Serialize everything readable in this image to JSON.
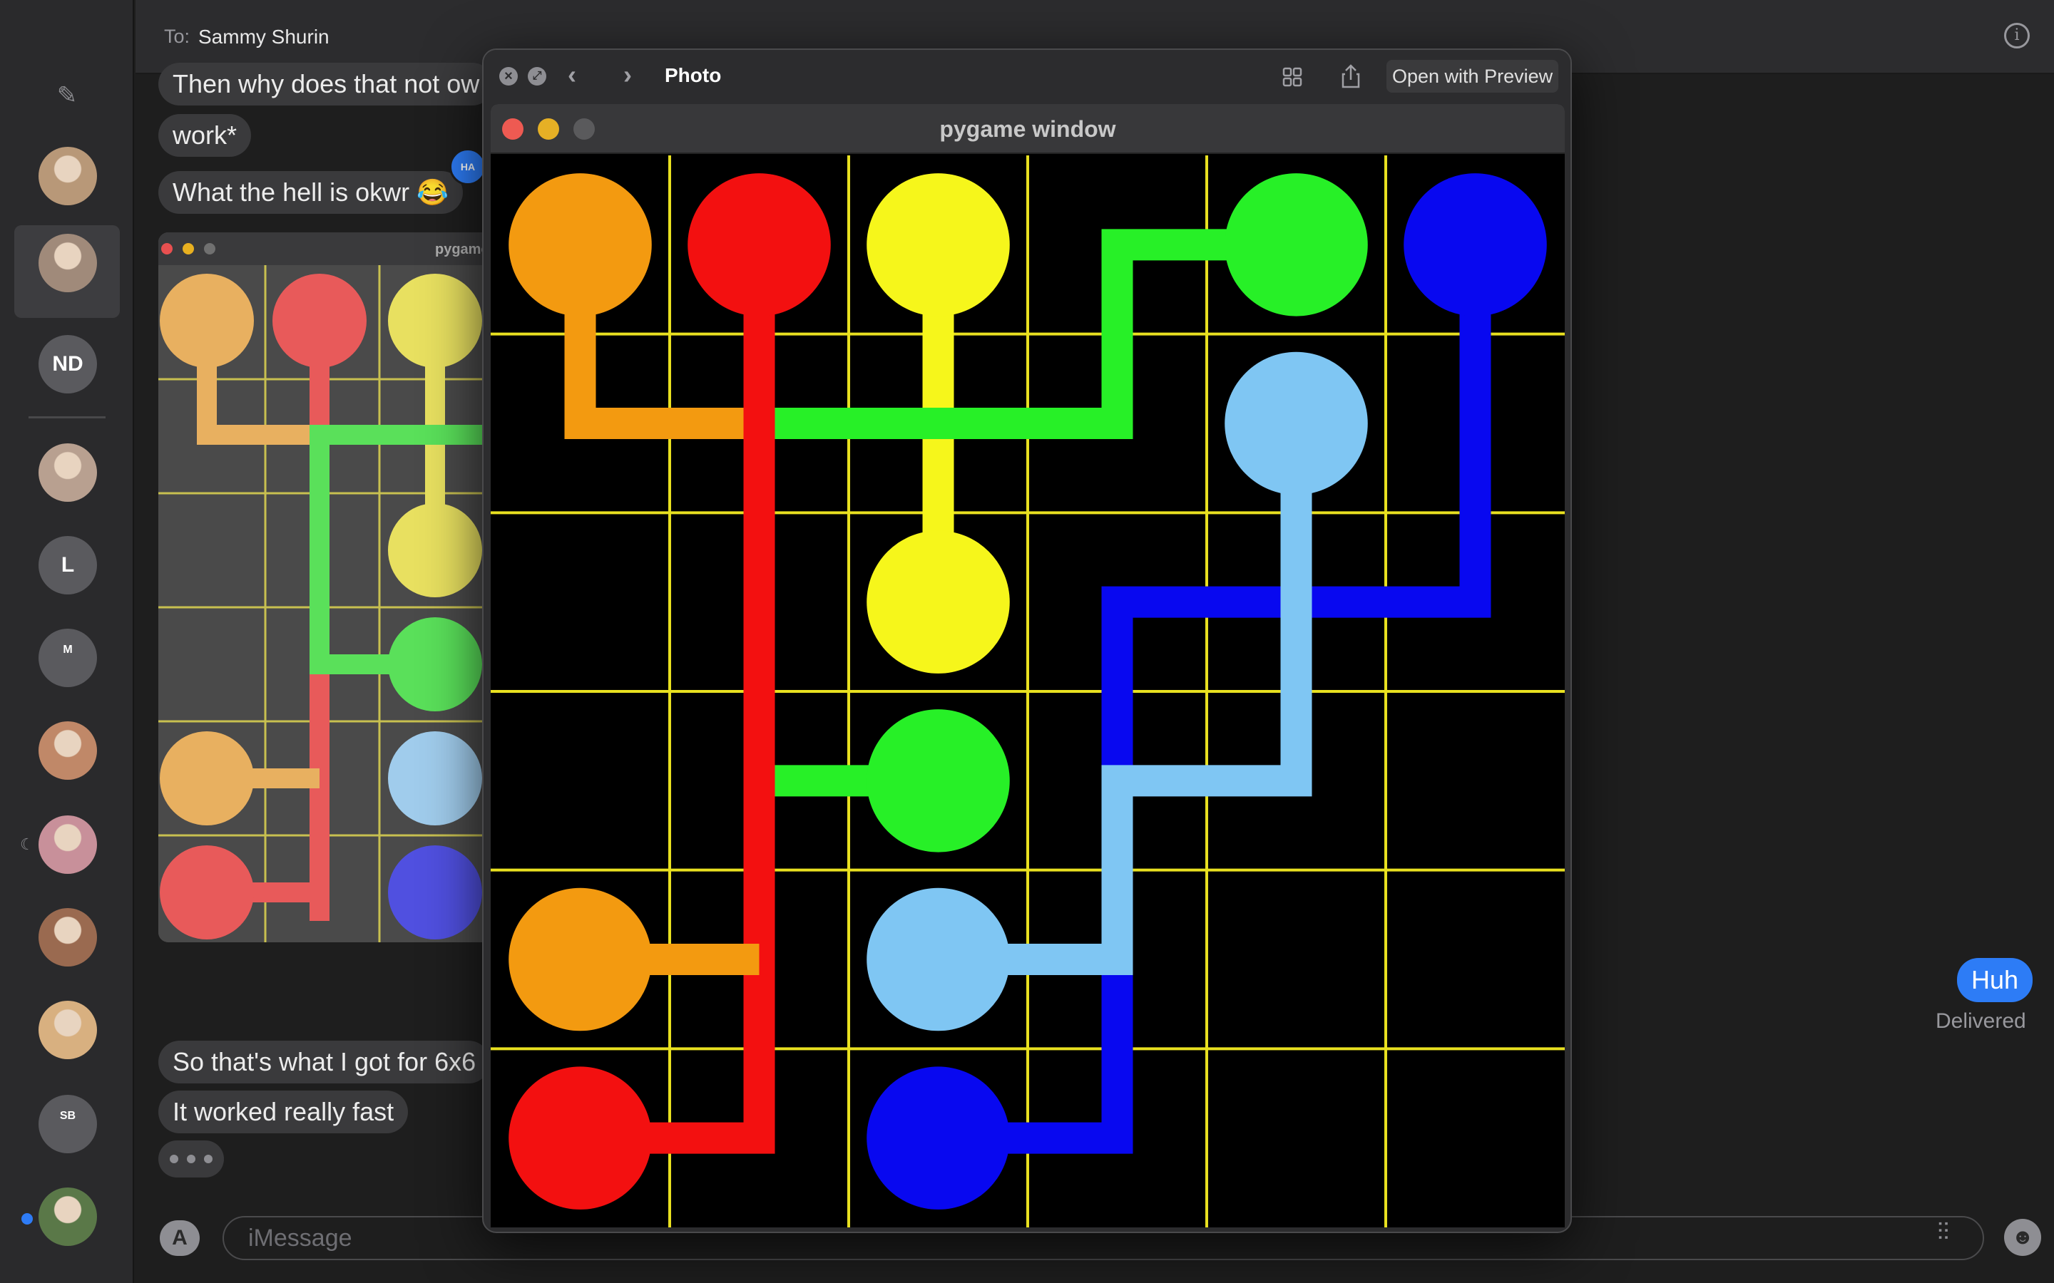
{
  "header": {
    "to_label": "To:",
    "to_name": "Sammy Shurin",
    "info_icon": "info-icon"
  },
  "sidebar": {
    "compose_icon": "compose-icon",
    "contacts": [
      {
        "type": "photo",
        "color": "#b89878"
      },
      {
        "type": "photo",
        "color": "#a08a7a",
        "selected": true
      },
      {
        "type": "initials",
        "label": "ND"
      },
      {
        "type": "photo",
        "color": "#b8a090"
      },
      {
        "type": "initials",
        "label": "L"
      },
      {
        "type": "group",
        "label": "M"
      },
      {
        "type": "photo",
        "color": "#c08868"
      },
      {
        "type": "photo",
        "color": "#c8909a"
      },
      {
        "type": "photo",
        "color": "#9a6a50"
      },
      {
        "type": "photo",
        "color": "#d8b080"
      },
      {
        "type": "group",
        "label": "SB"
      },
      {
        "type": "photo",
        "color": "#5a7848",
        "unread": true
      }
    ]
  },
  "chat": {
    "messages": [
      {
        "id": "m1",
        "text": "Then why does that not ow"
      },
      {
        "id": "m2",
        "text": "work*"
      },
      {
        "id": "m3",
        "text": "What the hell is okwr 😂",
        "tapback": "HA HA"
      },
      {
        "id": "m4",
        "text": "So that's what I got for 6x6"
      },
      {
        "id": "m5",
        "text": "It worked really fast"
      }
    ],
    "outgoing": {
      "text": "Huh",
      "status": "Delivered"
    },
    "thumbnail_title": "pygame window"
  },
  "input": {
    "placeholder": "iMessage",
    "apps_icon": "app-store-icon",
    "audio_icon": "waveform-icon",
    "emoji_icon": "emoji-icon"
  },
  "quicklook": {
    "title": "Photo",
    "open_with": "Open with Preview",
    "icons": [
      "close-icon",
      "fullscreen-icon",
      "chevron-left-icon",
      "chevron-right-icon",
      "grid-icon",
      "share-icon"
    ]
  },
  "pygame": {
    "title": "pygame window",
    "colors": {
      "orange": "#f39a10",
      "red": "#f31010",
      "yellow": "#f6f61b",
      "green": "#27f027",
      "blue": "#0808f0",
      "lightblue": "#7fc6f3",
      "grid": "#e8e020",
      "background": "#000000"
    },
    "grid_size": 6,
    "dots": [
      {
        "color": "orange",
        "row": 0,
        "col": 0
      },
      {
        "color": "red",
        "row": 0,
        "col": 1
      },
      {
        "color": "yellow",
        "row": 0,
        "col": 2
      },
      {
        "color": "green",
        "row": 0,
        "col": 4
      },
      {
        "color": "blue",
        "row": 0,
        "col": 5
      },
      {
        "color": "lightblue",
        "row": 1,
        "col": 4
      },
      {
        "color": "yellow",
        "row": 2,
        "col": 2
      },
      {
        "color": "green",
        "row": 3,
        "col": 2
      },
      {
        "color": "orange",
        "row": 4,
        "col": 0
      },
      {
        "color": "lightblue",
        "row": 4,
        "col": 2
      },
      {
        "color": "red",
        "row": 5,
        "col": 0
      },
      {
        "color": "blue",
        "row": 5,
        "col": 2
      }
    ],
    "paths": [
      {
        "color": "orange",
        "cells": [
          [
            0,
            0
          ],
          [
            1,
            0
          ],
          [
            1,
            1
          ]
        ]
      },
      {
        "color": "yellow",
        "cells": [
          [
            0,
            2
          ],
          [
            1,
            2
          ],
          [
            2,
            2
          ]
        ]
      },
      {
        "color": "green",
        "cells": [
          [
            0,
            4
          ],
          [
            0,
            3
          ],
          [
            1,
            3
          ],
          [
            1,
            2
          ],
          [
            1,
            1
          ],
          [
            2,
            1
          ],
          [
            3,
            1
          ],
          [
            3,
            2
          ]
        ]
      },
      {
        "color": "blue",
        "cells": [
          [
            0,
            5
          ],
          [
            1,
            5
          ],
          [
            2,
            5
          ],
          [
            2,
            4
          ],
          [
            2,
            3
          ],
          [
            3,
            3
          ],
          [
            4,
            3
          ],
          [
            5,
            3
          ],
          [
            5,
            2
          ]
        ]
      },
      {
        "color": "lightblue",
        "cells": [
          [
            1,
            4
          ],
          [
            2,
            4
          ],
          [
            3,
            4
          ],
          [
            3,
            3
          ],
          [
            4,
            3
          ],
          [
            4,
            2
          ]
        ]
      },
      {
        "color": "red",
        "cells": [
          [
            0,
            1
          ],
          [
            1,
            1
          ],
          [
            2,
            1
          ],
          [
            3,
            1
          ],
          [
            4,
            1
          ],
          [
            5,
            1
          ],
          [
            5,
            0
          ]
        ]
      },
      {
        "color": "orange",
        "cells": [
          [
            4,
            0
          ],
          [
            4,
            1
          ]
        ]
      }
    ]
  }
}
